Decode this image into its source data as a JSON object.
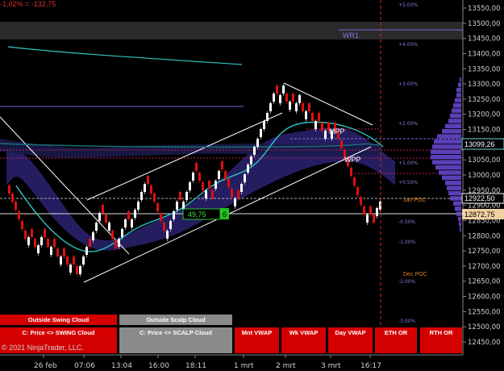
{
  "pnl_text": "-1,02% = -132,75",
  "copyright": "© 2021 NinjaTrader, LLC.",
  "price_labels": [
    "13550,00",
    "13500,00",
    "13450,00",
    "13400,00",
    "13350,00",
    "13300,00",
    "13250,00",
    "13200,00",
    "13150,00",
    "13100,00",
    "13050,00",
    "13000,00",
    "12950,00",
    "12900,00",
    "12850,00",
    "12800,00",
    "12750,00",
    "12700,00",
    "12650,00",
    "12600,00",
    "12550,00",
    "12500,00",
    "12450,00"
  ],
  "pct_labels": [
    "+5.00%",
    "+4.00%",
    "+3.00%",
    "+2.00%",
    "+1.00%",
    "+0.50%",
    "-0.50%",
    "-1.00%",
    "-2.00%",
    "-3.00%"
  ],
  "time_labels": [
    "26 feb",
    "07:06",
    "13:04",
    "16:00",
    "18:11",
    "1 mrt",
    "2 mrt",
    "3 mrt",
    "16:17"
  ],
  "price_tags": {
    "current": "13099,26",
    "high": "12922,50",
    "low": "12872,75"
  },
  "annotations": {
    "wr1": "WR1",
    "mpp": "MPP",
    "wpp": "WPP",
    "jan_poc": "Jan POC",
    "dec_poc": "Dec POC",
    "box_value": "49,75",
    "box_count": "6"
  },
  "buttons": {
    "outside_swing": "Outside Swing Cloud",
    "outside_scalp": "Outside Scalp Cloud",
    "price_swing": "C: Price <> SWING Cloud",
    "price_scalp": "C: Price <> SCALP Cloud",
    "mnt_vwap": "Mnt VWAP",
    "wk_vwap": "Wk VWAP",
    "day_vwap": "Day VWAP",
    "eth_or": "ETH OR",
    "rth_or": "RTH OR"
  },
  "colors": {
    "up_bar": "#ffffff",
    "down_bar": "#e01010",
    "cloud": "#3a2a80",
    "vwap": "#2ec4c4",
    "red_button": "#d40000",
    "gray_button": "#808080",
    "volume_profile": "#6a4ad8"
  },
  "chart_data": {
    "type": "renko",
    "y_range": [
      12425,
      13575
    ],
    "current_price": 13099.26
  }
}
